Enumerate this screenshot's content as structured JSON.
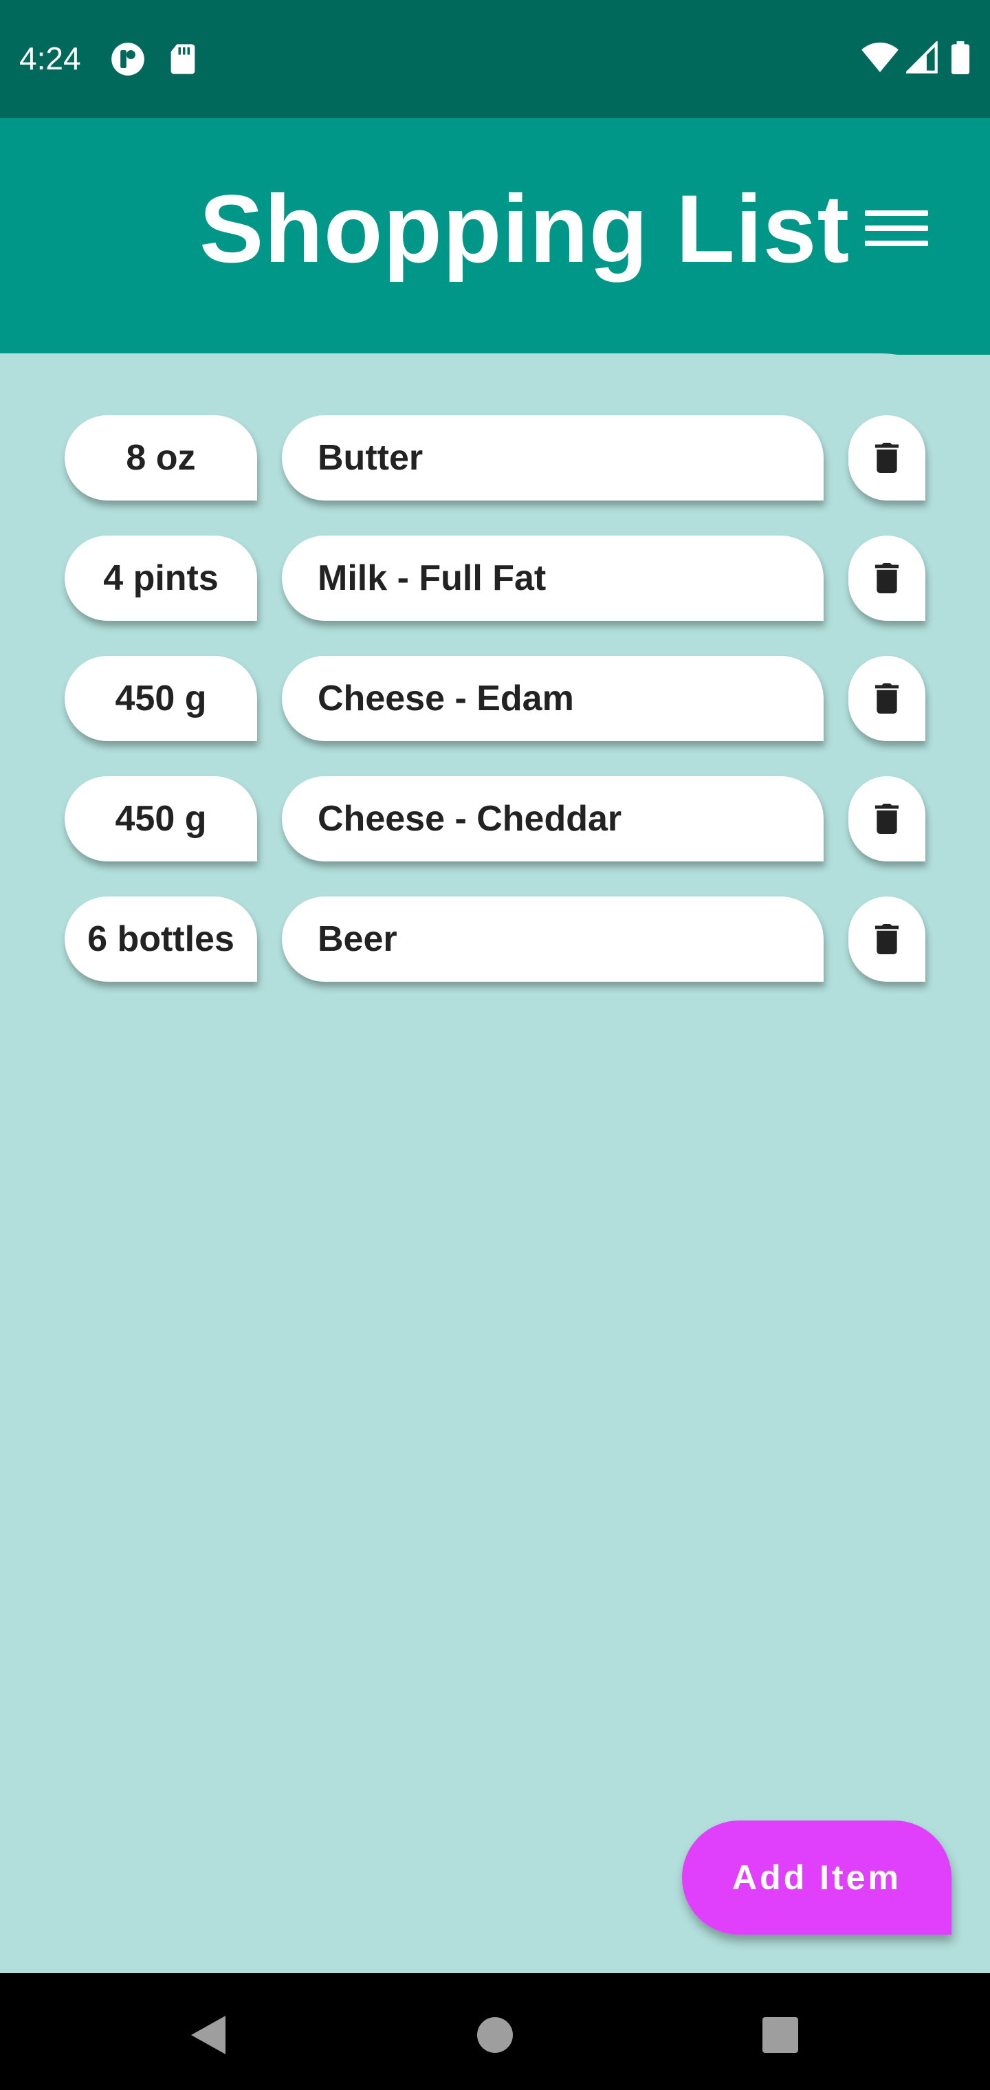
{
  "status_bar": {
    "time": "4:24",
    "icons_left": [
      "circle-app-icon",
      "sd-card-icon"
    ],
    "icons_right": [
      "wifi-icon",
      "signal-icon",
      "battery-icon"
    ]
  },
  "app_bar": {
    "title": "Shopping List",
    "menu_icon": "hamburger-menu-icon"
  },
  "items": [
    {
      "quantity": "8 oz",
      "name": "Butter"
    },
    {
      "quantity": "4 pints",
      "name": "Milk - Full Fat"
    },
    {
      "quantity": "450 g",
      "name": "Cheese - Edam"
    },
    {
      "quantity": "450 g",
      "name": "Cheese - Cheddar"
    },
    {
      "quantity": "6 bottles",
      "name": "Beer"
    }
  ],
  "delete_icon": "trash-icon",
  "add_button": {
    "label": "Add Item"
  },
  "nav_bar": {
    "icons": [
      "back-icon",
      "home-icon",
      "recents-icon"
    ]
  },
  "colors": {
    "status_bar": "#00695c",
    "app_bar": "#009688",
    "background": "#b2dfdb",
    "chip": "#ffffff",
    "text": "#222222",
    "accent": "#e040fb",
    "nav_bar": "#000000"
  }
}
